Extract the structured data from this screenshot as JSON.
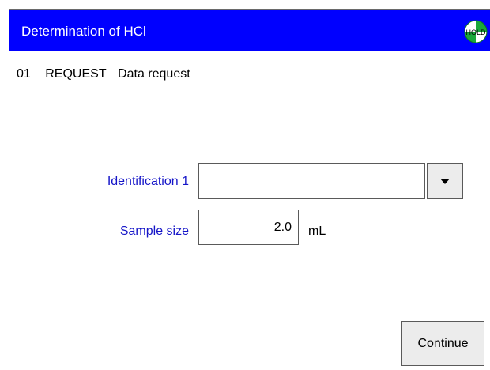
{
  "window": {
    "title": "Determination of HCl",
    "status_indicator": {
      "label": "HOLD",
      "colors": [
        "#00aa00",
        "#ffffff"
      ]
    }
  },
  "step": {
    "number": "01",
    "type": "REQUEST",
    "description": "Data request"
  },
  "form": {
    "identification": {
      "label": "Identification 1",
      "value": "",
      "dropdown_icon": "chevron-down-icon"
    },
    "sample_size": {
      "label": "Sample size",
      "value": "2.0",
      "unit": "mL"
    }
  },
  "actions": {
    "continue_label": "Continue"
  },
  "colors": {
    "titlebar": "#0000ff",
    "label_text": "#1515c8",
    "button_background": "#ececec"
  }
}
